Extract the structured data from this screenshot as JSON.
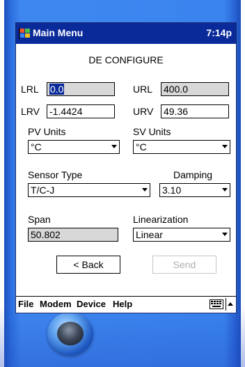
{
  "window": {
    "title": "Main Menu",
    "time": "7:14p"
  },
  "form": {
    "heading": "DE CONFIGURE",
    "lrl": {
      "label": "LRL",
      "value": "0.0"
    },
    "url": {
      "label": "URL",
      "value": "400.0"
    },
    "lrv": {
      "label": "LRV",
      "value": "-1.4424"
    },
    "urv": {
      "label": "URV",
      "value": "49.36"
    },
    "pv_units": {
      "label": "PV Units",
      "value": "°C"
    },
    "sv_units": {
      "label": "SV Units",
      "value": "°C"
    },
    "sensor_type": {
      "label": "Sensor Type",
      "value": "T/C-J"
    },
    "damping": {
      "label": "Damping",
      "value": "3.10"
    },
    "span": {
      "label": "Span",
      "value": "50.802"
    },
    "linearization": {
      "label": "Linearization",
      "value": "Linear"
    }
  },
  "buttons": {
    "back": "< Back",
    "send": "Send"
  },
  "menu": {
    "items": [
      "File",
      "Modem",
      "Device",
      "Help"
    ]
  },
  "colors": {
    "titlebar": "#0a2a9a",
    "device_body": "#3a84ef",
    "readonly_field": "#d8d8d8",
    "disabled_text": "#b0b0b0"
  },
  "icons": {
    "app": "windows-flag-icon",
    "keyboard": "keyboard-icon",
    "sip_toggle": "up-arrow-icon"
  }
}
